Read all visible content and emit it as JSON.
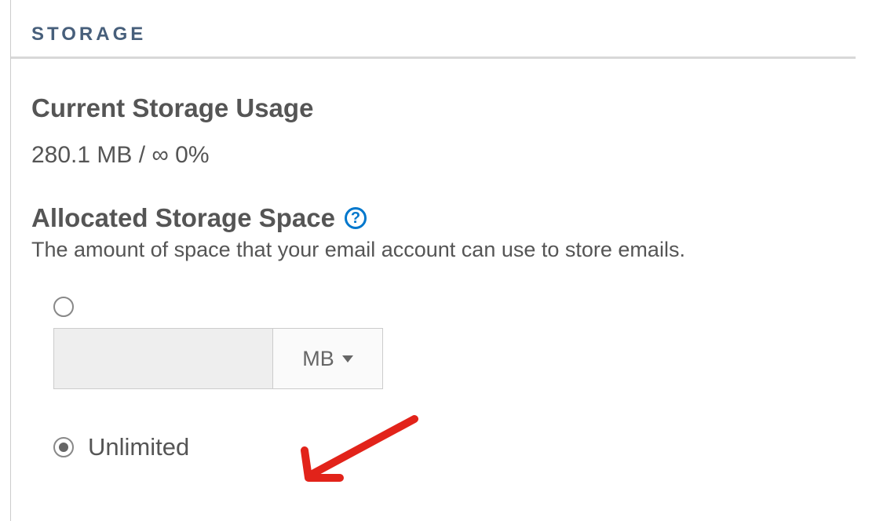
{
  "section_title": "STORAGE",
  "current_usage": {
    "heading": "Current Storage Usage",
    "value": "280.1 MB / ∞ 0%"
  },
  "allocated": {
    "heading": "Allocated Storage Space",
    "description": "The amount of space that your email account can use to store emails."
  },
  "options": {
    "custom": {
      "selected": false,
      "amount": "",
      "unit": "MB"
    },
    "unlimited": {
      "selected": true,
      "label": "Unlimited"
    }
  }
}
